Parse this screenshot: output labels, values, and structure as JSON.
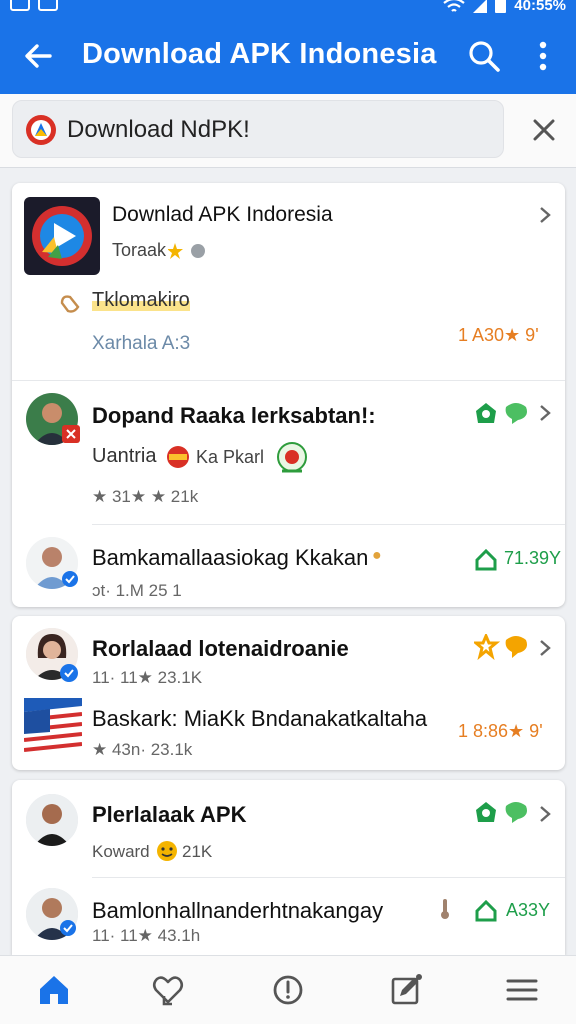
{
  "status_bar": {
    "time": "40:55%"
  },
  "app_bar": {
    "title": "Download APK Indonesia"
  },
  "search": {
    "query": "Download NdPK!"
  },
  "card1": {
    "app_name": "Downlad APK Indoresia",
    "developer": "Toraak",
    "category": "Tklomakiro",
    "meta": "Xarhala A:3",
    "rating": "1 A30★ 9'"
  },
  "card2": {
    "row1": {
      "title": "Dopand Raaka lerksabtan!:",
      "subtitle": "Uantria",
      "subtitle2": "Ka Pkarl",
      "stats": "★ 31★ ★ 21k"
    },
    "row2": {
      "title": "Bamkamallaasiokag Kkakan",
      "meta": "ɔt· 1.M  25 1",
      "count": "71.39Y"
    }
  },
  "card3": {
    "row1": {
      "title": "Rorlalaad lotenaidroanie",
      "meta": "11· 11★ 23.1K"
    },
    "row2": {
      "title": "Baskark: MiaKk Bndanakatkaltaha",
      "meta": "★ 43n· 23.1k",
      "rating": "1 8:86★ 9'"
    }
  },
  "card4": {
    "row1": {
      "title": "Plerlalaak APK",
      "meta": "Koward",
      "meta2": "21K"
    },
    "row2": {
      "title": "Bamlonhallnanderhtnakangay",
      "meta": "11· 11★ 43.1h",
      "count": "A33Y"
    }
  },
  "colors": {
    "primary": "#1a73e8",
    "green": "#1e9e4a",
    "orange": "#e67e22"
  }
}
